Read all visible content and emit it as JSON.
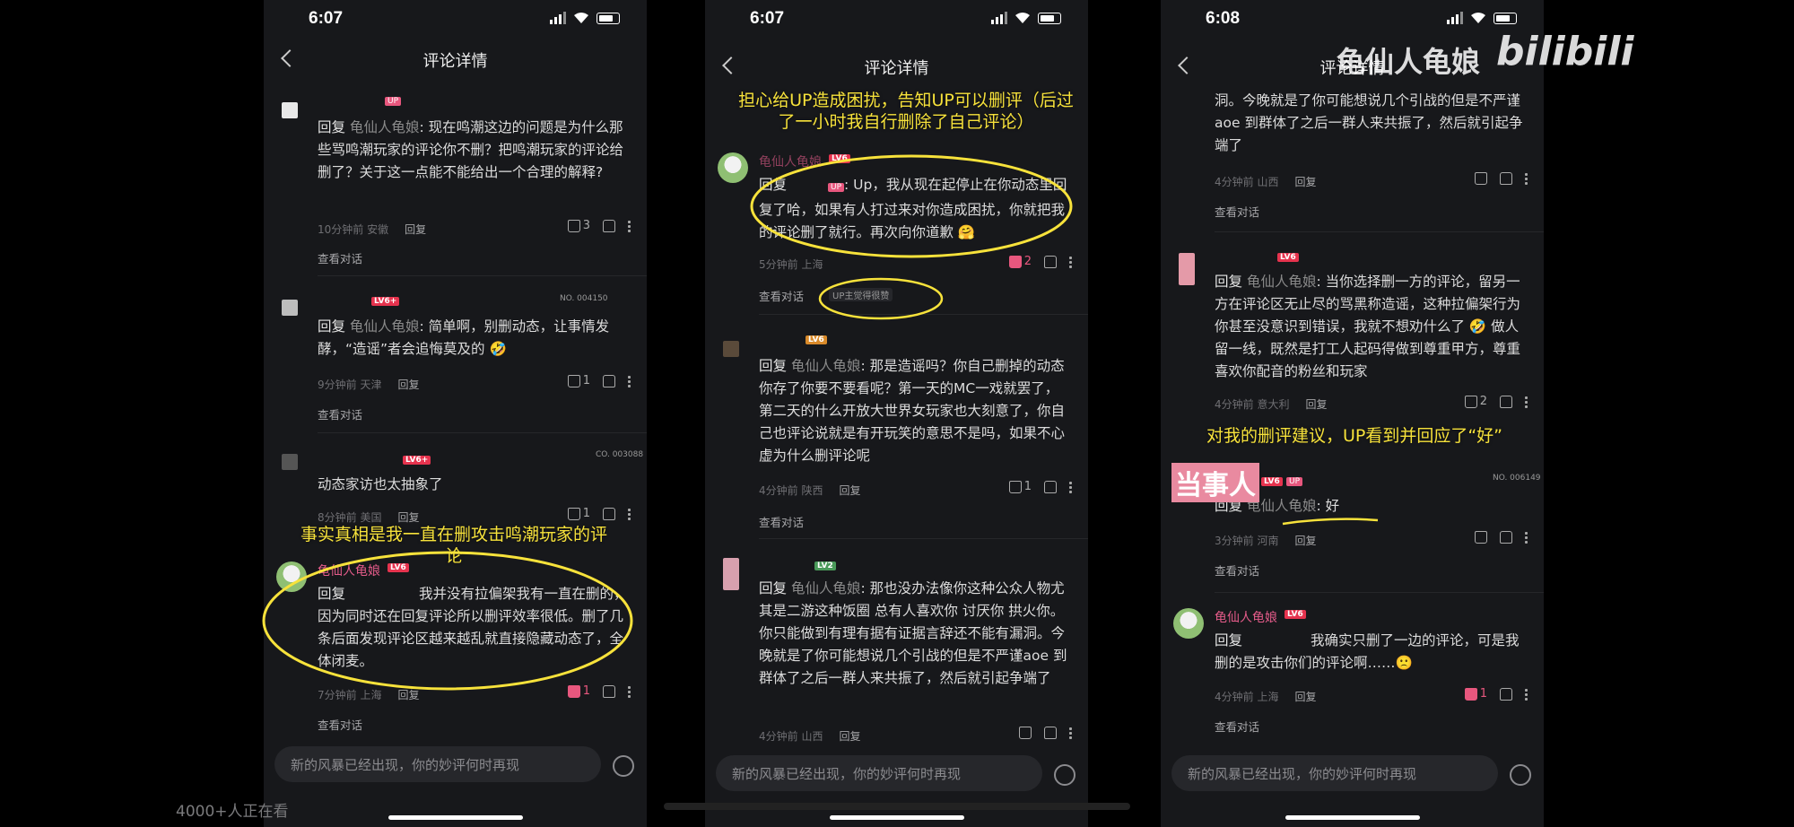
{
  "screens": [
    {
      "time": "6:07",
      "title": "评论详情",
      "input_placeholder": "新的风暴已经出现，你的妙评何时再现",
      "comments": [
        {
          "re": "回复",
          "mention": "龟仙人龟娘",
          "text": "现在鸣潮这边的问题是为什么那些骂鸣潮玩家的评论你不删？把鸣潮玩家的评论给删了？关于这一点能不能给出一个合理的解释?",
          "meta": "10分钟前 安徽",
          "reply": "回复",
          "likes": "3",
          "view": "查看对话",
          "badge": "UP"
        },
        {
          "re": "回复",
          "mention": "龟仙人龟娘",
          "text": "简单啊，别删动态，让事情发酵，“造谣”者会追悔莫及的 🤣",
          "meta": "9分钟前 天津",
          "reply": "回复",
          "likes": "1",
          "view": "查看对话",
          "level": "LV6+",
          "sticker": "NO. 004150"
        },
        {
          "text": "动态家访也太抽象了",
          "meta": "8分钟前 美国",
          "reply": "回复",
          "likes": "1",
          "level": "LV6+",
          "sticker": "CO. 003088"
        },
        {
          "name": "龟仙人龟娘",
          "level": "LV6",
          "re": "回复",
          "text": "我并没有拉偏架我有一直在删的，因为同时还在回复评论所以删评效率很低。删了几条后面发现评论区越来越乱就直接隐藏动态了，全体闭麦。",
          "meta": "7分钟前 上海",
          "reply": "回复",
          "likes": "1",
          "view": "查看对话"
        }
      ],
      "annotation": "事实真相是我一直在删攻击鸣潮玩家的评论"
    },
    {
      "time": "6:07",
      "title": "评论详情",
      "input_placeholder": "新的风暴已经出现，你的妙评何时再现",
      "annotation": "担心给UP造成困扰，告知UP可以删评（后过了一小时我自行删除了自己评论）",
      "comments": [
        {
          "name": "龟仙人龟娘",
          "level": "LV6",
          "re": "回复",
          "up": "UP",
          "text": ": Up，我从现在起停止在你动态里回复了哈，如果有人打过来对你造成困扰，你就把我的评论删了就行。再次向你道歉 🤗",
          "meta": "5分钟前 上海",
          "likes": "2",
          "view": "查看对话",
          "up_liked": "UP主觉得很赞"
        },
        {
          "re": "回复",
          "mention": "龟仙人龟娘",
          "text": "那是造谣吗？你自己删掉的动态你存了你要不要看呢？第一天的MC一戏就罢了，第二天的什么开放大世界女玩家也大刻意了，你自己也评论说就是有开玩笑的意思不是吗，如果不心虚为什么删评论呢",
          "meta": "4分钟前 陕西",
          "reply": "回复",
          "likes": "1",
          "view": "查看对话",
          "level": "LV6"
        },
        {
          "re": "回复",
          "mention": "龟仙人龟娘",
          "text": "那也没办法像你这种公众人物尤其是二游这种饭圈 总有人喜欢你 讨厌你 拱火你。 你只能做到有理有据有证据言辞还不能有漏洞。今晚就是了你可能想说几个引战的但是不严谨aoe 到群体了之后一群人来共振了，然后就引起争端了",
          "meta": "4分钟前 山西",
          "reply": "回复",
          "level": "LV2"
        }
      ]
    },
    {
      "time": "6:08",
      "title": "评论详情",
      "input_placeholder": "新的风暴已经出现，你的妙评何时再现",
      "annotation": "对我的删评建议，UP看到并回应了“好”",
      "tag": "当事人",
      "watermark": "龟仙人龟娘",
      "logo": "bilibili",
      "comments": [
        {
          "text": "洞。今晚就是了你可能想说几个引战的但是不严谨aoe 到群体了之后一群人来共振了，然后就引起争端了",
          "meta": "4分钟前 山西",
          "reply": "回复",
          "view": "查看对话"
        },
        {
          "re": "回复",
          "mention": "龟仙人龟娘",
          "text": "当你选择删一方的评论，留另一方在评论区无止尽的骂黑称造谣，这种拉偏架行为你甚至没意识到错误，我就不想劝什么了 🤣 做人留一线，既然是打工人起码得做到尊重甲方，尊重喜欢你配音的粉丝和玩家",
          "meta": "4分钟前 意大利",
          "reply": "回复",
          "likes": "2",
          "view": "",
          "level": "LV6"
        },
        {
          "re": "回复",
          "mention": "龟仙人龟娘",
          "text": "好",
          "meta": "3分钟前 河南",
          "reply": "回复",
          "view": "查看对话",
          "level": "LV6",
          "up": "UP",
          "sticker": "NO. 006149"
        },
        {
          "name": "龟仙人龟娘",
          "level": "LV6",
          "re": "回复",
          "text": "我确实只删了一边的评论，可是我删的是攻击你们的评论啊……🙁",
          "meta": "4分钟前 上海",
          "reply": "回复",
          "likes": "1",
          "view": "查看对话"
        }
      ]
    }
  ],
  "viewers": "4000+人正在看",
  "colors": {
    "accent_pink": "#e8577e",
    "annotation_yellow": "#f7e23b",
    "bg": "#17181b"
  }
}
